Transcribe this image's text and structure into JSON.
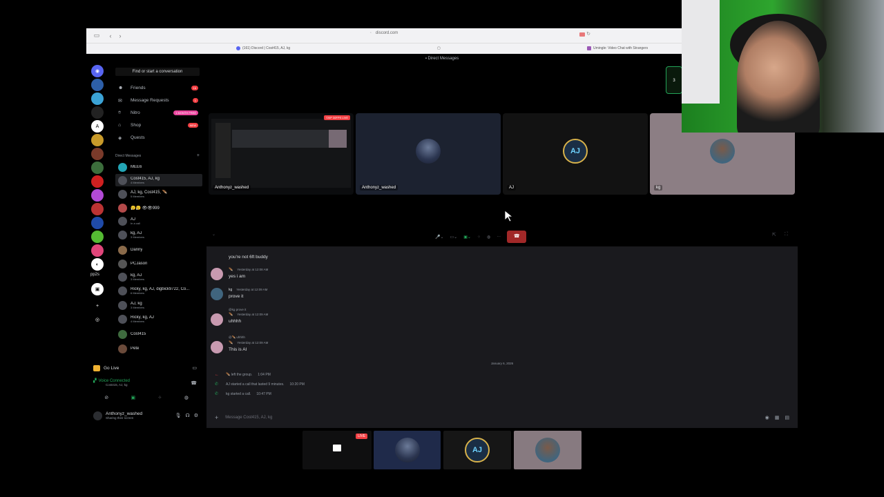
{
  "browser": {
    "address": "discord.com",
    "tab_left": "(161) Discord | Cost415, AJ, kg",
    "tab_right": "Umingle: Video Chat with Strangers"
  },
  "app": {
    "window_title": "Direct Messages"
  },
  "server_rail": {
    "folder_label": "pp2s"
  },
  "dm_sidebar": {
    "find_placeholder": "Find or start a conversation",
    "nav": [
      {
        "label": "Friends",
        "badge": "16"
      },
      {
        "label": "Message Requests",
        "badge": "1"
      },
      {
        "label": "Nitro",
        "badge": "1 MONTH FREE"
      },
      {
        "label": "Shop",
        "badge": "NEW"
      },
      {
        "label": "Quests",
        "badge": ""
      }
    ],
    "section_header": "Direct Messages",
    "conversations": [
      {
        "name": "MEE6",
        "sub": ""
      },
      {
        "name": "Cost415, AJ, kg",
        "sub": "4 Members"
      },
      {
        "name": "AJ, kg, Cost415, 🪶",
        "sub": "5 Members"
      },
      {
        "name": "😮‍💨😮‍💨 👁👁999",
        "sub": ""
      },
      {
        "name": "AJ",
        "sub": "In a call"
      },
      {
        "name": "kg, AJ",
        "sub": "3 Members"
      },
      {
        "name": "Danny",
        "sub": ""
      },
      {
        "name": "PCJason",
        "sub": ""
      },
      {
        "name": "kg, AJ",
        "sub": "3 Members"
      },
      {
        "name": "Ricky, kg, AJ, digbick9722, Co...",
        "sub": "6 Members"
      },
      {
        "name": "AJ, kg",
        "sub": "3 Members"
      },
      {
        "name": "Ricky, kg, AJ",
        "sub": "4 Members"
      },
      {
        "name": "Cost415",
        "sub": ""
      },
      {
        "name": "Pete",
        "sub": ""
      }
    ]
  },
  "voice_panel": {
    "go_live": "Go Live",
    "status": "Voice Connected",
    "channel": "Cost415, AJ, kg"
  },
  "user": {
    "name": "Anthonyz_washed",
    "status": "Sharing their screen"
  },
  "call": {
    "live_tag": "720P 30FPS LIVE",
    "tiles": [
      {
        "name": "Anthonyz_washed"
      },
      {
        "name": "Anthonyz_washed"
      },
      {
        "name": "AJ"
      },
      {
        "name": "kg"
      }
    ],
    "aj_avatar_text": "AJ",
    "side_count": "3"
  },
  "chat": {
    "messages": [
      {
        "text": "you're not 6ft buddy"
      },
      {
        "author": "🪶",
        "time": "Yesterday at 12:08 AM",
        "text": "yes i am"
      },
      {
        "author": "kg",
        "time": "Yesterday at 12:09 AM",
        "text": "prove it"
      },
      {
        "reply": "@kg prove it",
        "author": "🪶",
        "time": "Yesterday at 12:09 AM",
        "text": "uhhhh"
      },
      {
        "reply": "@🪶 uhhhh",
        "author": "🪶",
        "time": "Yesterday at 12:09 AM",
        "text": "This is AI"
      }
    ],
    "date_divider": "January 6, 2026",
    "system": [
      {
        "text": "🪶 left the group.",
        "time": "1:04 PM"
      },
      {
        "text": "AJ started a call that lasted 9 minutes.",
        "time": "10:20 PM"
      },
      {
        "text": "kg started a call.",
        "time": "10:47 PM"
      }
    ],
    "composer_placeholder": "Message Cost415, AJ, kg"
  },
  "tray": {
    "live_tag": "LIVE"
  }
}
